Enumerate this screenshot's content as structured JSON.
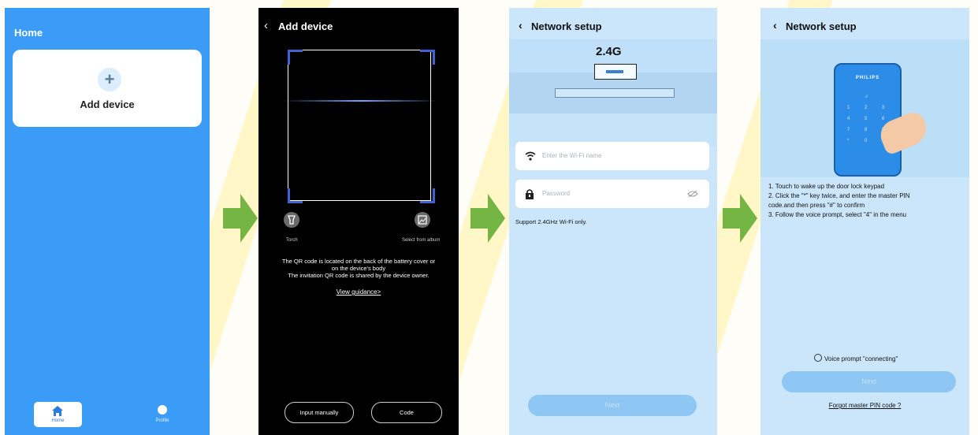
{
  "screen1": {
    "title": "Home",
    "add_card_label": "Add device",
    "tabs": [
      {
        "label": "Home",
        "icon": "home-icon"
      },
      {
        "label": "Profile",
        "icon": "smiley-icon"
      }
    ]
  },
  "screen2": {
    "title": "Add device",
    "torch_label": "Torch",
    "album_label": "Select from album",
    "info_lines": [
      "The QR code is located on the back of the battery cover or",
      "on the device's body",
      "The invitation QR code is shared by the device owner."
    ],
    "guidance_link": "View guidance>",
    "input_manually": "Input manually",
    "code_button": "Code"
  },
  "screen3": {
    "title": "Network setup",
    "band_label": "2.4G",
    "wifi_placeholder": "Enter the Wi-Fi name",
    "password_placeholder": "Password",
    "support_note": "Support 2.4GHz Wi-Fi only.",
    "next_label": "Next"
  },
  "screen4": {
    "title": "Network setup",
    "brand": "PHILIPS",
    "steps": [
      "1. Touch to wake up the door lock keypad",
      "2. Click the \"*\" key twice, and enter the master PIN",
      "code.and then press \"#\" to confirm",
      "3. Follow the voice prompt, select \"4\" in the menu"
    ],
    "voice_prompt": "Voice prompt \"connecting\"",
    "next_label": "Next",
    "forgot_link": "Forgot master PIN code",
    "forgot_mark": "?"
  },
  "colors": {
    "home_blue": "#3b9cf7",
    "scanner_accent": "#3f63d6",
    "arrow_green": "#74b543",
    "setup_bg": "#cbe6fb"
  }
}
